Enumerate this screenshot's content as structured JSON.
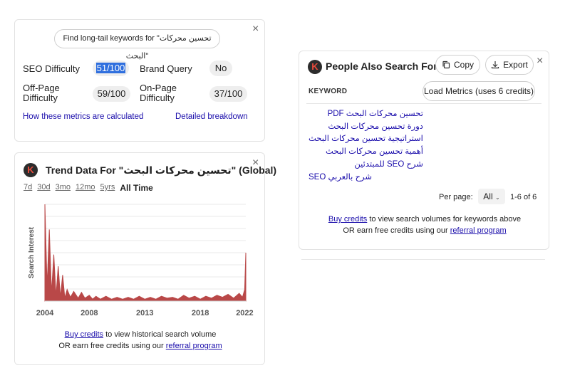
{
  "metrics_card": {
    "longtail_button": "Find long-tail keywords for \"تحسين محركات البحث\"",
    "rows": [
      {
        "left_label": "SEO Difficulty",
        "left_value": "51/100",
        "right_label": "Brand Query",
        "right_value": "No"
      },
      {
        "left_label": "Off-Page Difficulty",
        "left_value": "59/100",
        "right_label": "On-Page Difficulty",
        "right_value": "37/100"
      }
    ],
    "how_link": "How these metrics are calculated",
    "breakdown_link": "Detailed breakdown",
    "close": "×"
  },
  "trend_card": {
    "logo": "K",
    "title": "Trend Data For \"تحسين محركات البحث\" (Global)",
    "ranges": [
      "7d",
      "30d",
      "3mo",
      "12mo",
      "5yrs",
      "All Time"
    ],
    "active_range": "All Time",
    "ylabel": "Search Interest",
    "buy_link": "Buy credits",
    "buy_text": " to view historical search volume",
    "earn_text": "OR earn free credits using our ",
    "referral_link": "referral program",
    "close": "×"
  },
  "chart_data": {
    "type": "area",
    "ylabel": "Search Interest",
    "xlabel": "",
    "xticks": [
      "2004",
      "2008",
      "2013",
      "2018",
      "2022"
    ],
    "xlim": [
      2004,
      2022.1
    ],
    "ylim": [
      0,
      100
    ],
    "color": "#b94848",
    "x": [
      2004.0,
      2004.2,
      2004.4,
      2004.6,
      2004.8,
      2005.0,
      2005.2,
      2005.4,
      2005.6,
      2005.8,
      2006.0,
      2006.3,
      2006.6,
      2007.0,
      2007.3,
      2007.6,
      2008.0,
      2008.3,
      2008.6,
      2009.0,
      2009.5,
      2010.0,
      2010.5,
      2011.0,
      2011.5,
      2012.0,
      2012.5,
      2013.0,
      2013.5,
      2014.0,
      2014.5,
      2015.0,
      2015.5,
      2016.0,
      2016.5,
      2017.0,
      2017.5,
      2018.0,
      2018.5,
      2019.0,
      2019.5,
      2020.0,
      2020.5,
      2021.0,
      2021.5,
      2021.8,
      2022.0,
      2022.1
    ],
    "y": [
      100,
      15,
      74,
      8,
      48,
      5,
      36,
      4,
      27,
      3,
      12,
      4,
      10,
      3,
      9,
      3,
      6,
      2,
      5,
      2,
      5,
      2,
      4,
      2,
      4,
      2,
      5,
      2,
      4,
      2,
      5,
      3,
      4,
      2,
      6,
      3,
      5,
      2,
      5,
      3,
      6,
      4,
      7,
      3,
      8,
      4,
      12,
      50
    ]
  },
  "pasf_card": {
    "logo": "K",
    "title": "People Also Search For",
    "copy_label": "Copy",
    "export_label": "Export",
    "column_header": "KEYWORD",
    "load_metrics_label": "Load Metrics (uses 6 credits)",
    "keywords": [
      "تحسين محركات البحث PDF",
      "دورة تحسين محركات البحث",
      "استراتيجية تحسين محركات البحث",
      "أهمية تحسين محركات البحث",
      "شرح SEO للمبتدئين",
      "SEO شرح بالعربي"
    ],
    "per_page_label": "Per page:",
    "per_page_value": "All",
    "range_text": "1-6 of 6",
    "buy_link": "Buy credits",
    "buy_text": " to view search volumes for keywords above",
    "earn_text": "OR earn free credits using our ",
    "referral_link": "referral program",
    "close": "×"
  }
}
